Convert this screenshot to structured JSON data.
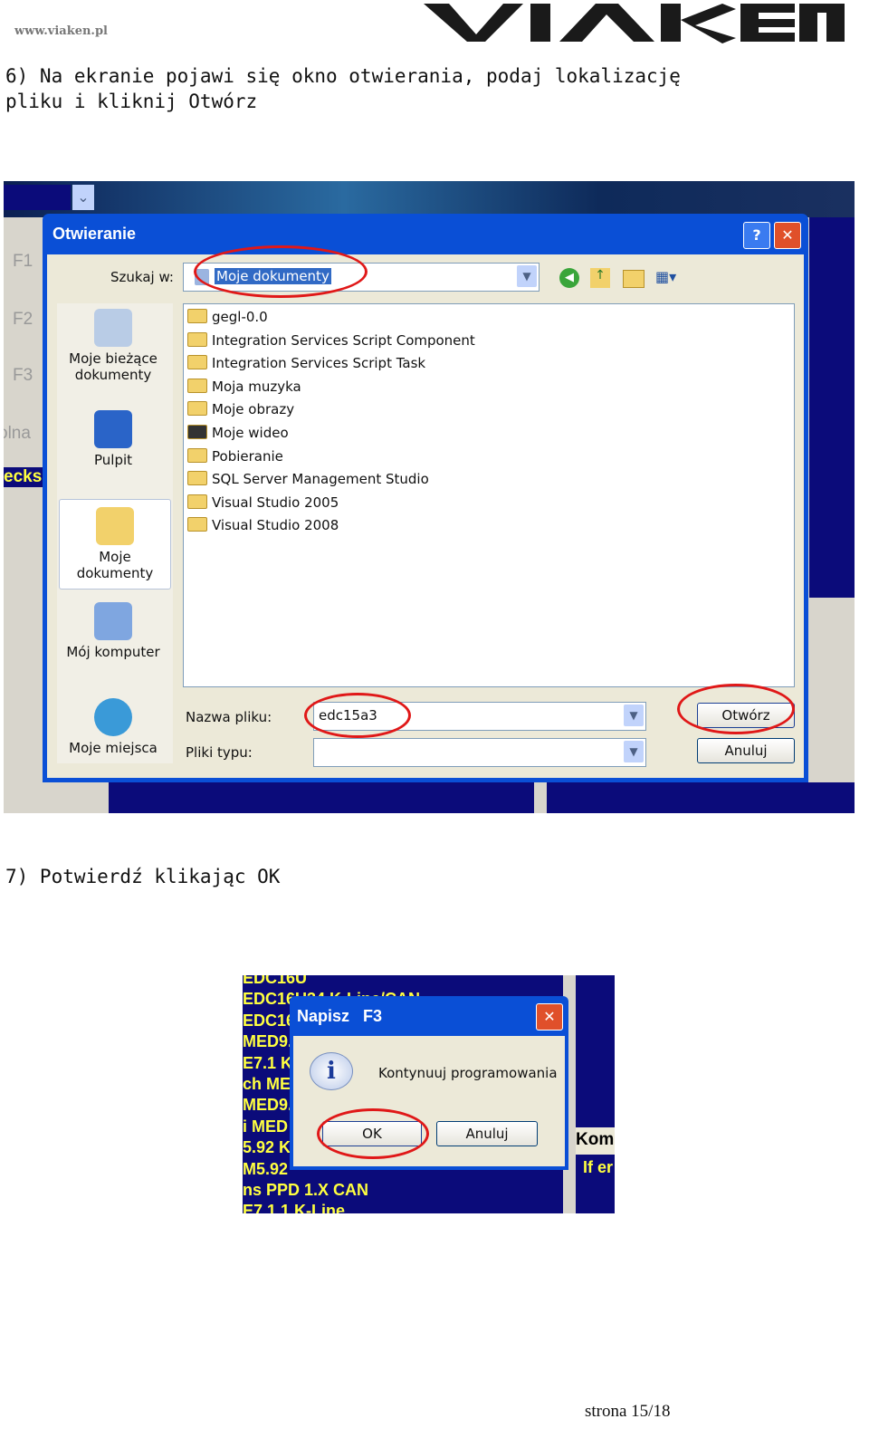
{
  "header": {
    "site": "www.viaken.pl",
    "logo": "VIAKEN"
  },
  "step6": {
    "text_line1": "6) Na ekranie pojawi się okno otwierania, podaj lokalizację",
    "text_line2": "pliku i kliknij Otwórz"
  },
  "open_dialog": {
    "title": "Otwieranie",
    "look_in_label": "Szukaj w:",
    "look_in_value": "Moje dokumenty",
    "bg_side_labels": [
      "F1",
      "F2",
      "F3",
      "olna",
      "ecksu"
    ],
    "places": [
      "Moje bieżące dokumenty",
      "Pulpit",
      "Moje dokumenty",
      "Mój komputer",
      "Moje miejsca"
    ],
    "files": [
      "gegl-0.0",
      "Integration Services Script Component",
      "Integration Services Script Task",
      "Moja muzyka",
      "Moje obrazy",
      "Moje wideo",
      "Pobieranie",
      "SQL Server Management Studio",
      "Visual Studio 2005",
      "Visual Studio 2008"
    ],
    "filename_label": "Nazwa pliku:",
    "filename_value": "edc15a3",
    "filetype_label": "Pliki typu:",
    "filetype_value": "",
    "open_button": "Otwórz",
    "cancel_button": "Anuluj"
  },
  "step7": {
    "text": "7) Potwierdź klikając OK"
  },
  "confirm_dialog": {
    "title": "Napisz   F3",
    "message": "Kontynuuj programowania",
    "ok_button": "OK",
    "cancel_button": "Anuluj",
    "bg_list": [
      "EDC16U34 K-Line/CAN",
      "EDC16",
      "MED9.",
      "E7.1 K",
      "ch ME",
      "MED9.",
      "i MED",
      "5.92 K",
      "M5.92",
      "ns PPD 1.X CAN",
      "E7.1.1 K-Line"
    ],
    "bg_right": [
      "Kom",
      "If er"
    ]
  },
  "footer": {
    "page": "strona 15/18"
  },
  "colors": {
    "xp_blue": "#0a4fd6",
    "dialog_bg": "#ece9d8",
    "app_navy": "#0b0b7a",
    "highlight_red": "#e01818"
  }
}
